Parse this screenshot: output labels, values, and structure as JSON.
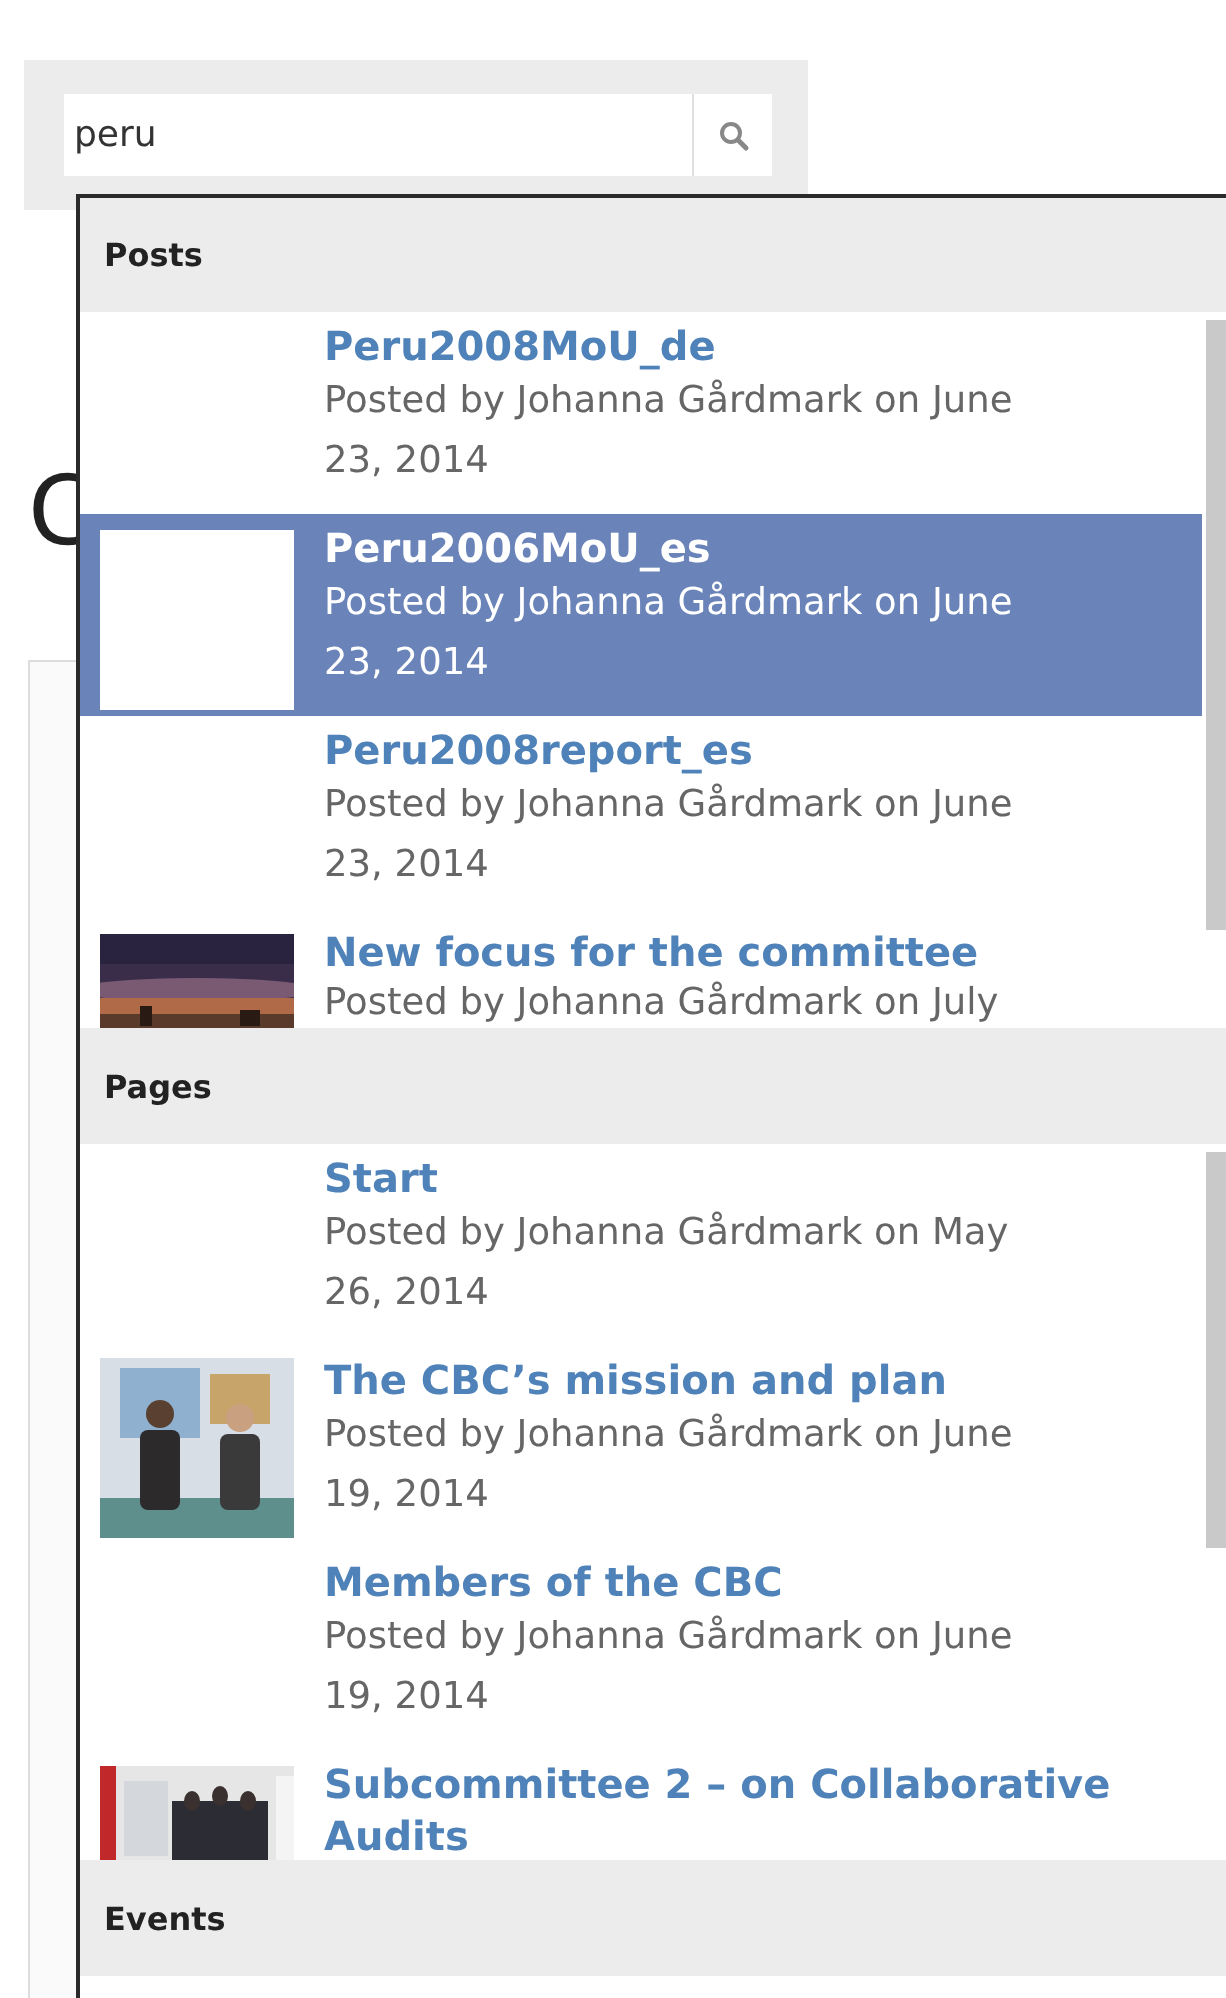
{
  "search": {
    "value": "peru"
  },
  "heading": "C",
  "sections": [
    {
      "title": "Posts",
      "items": [
        {
          "title": "Peru2008MoU_de",
          "meta": "Posted by Johanna Gårdmark on June 23, 2014",
          "selected": false,
          "kind": "text"
        },
        {
          "title": "Peru2006MoU_es",
          "meta": "Posted by Johanna Gårdmark on June 23, 2014",
          "selected": true,
          "kind": "blank"
        },
        {
          "title": "Peru2008report_es",
          "meta": "Posted by Johanna Gårdmark on June 23, 2014",
          "selected": false,
          "kind": "text"
        },
        {
          "title": "New focus for the committee",
          "meta": "Posted by Johanna Gårdmark on July",
          "selected": false,
          "kind": "picture"
        }
      ]
    },
    {
      "title": "Pages",
      "items": [
        {
          "title": "Start",
          "meta": "Posted by Johanna Gårdmark on May 26, 2014",
          "selected": false,
          "kind": "text"
        },
        {
          "title": "The CBC’s mission and plan",
          "meta": "Posted by Johanna Gårdmark on June 19, 2014",
          "selected": false,
          "kind": "picture"
        },
        {
          "title": "Members of the CBC",
          "meta": "Posted by Johanna Gårdmark on June 19, 2014",
          "selected": false,
          "kind": "text"
        },
        {
          "title": "Subcommittee 2 – on Collaborative Audits",
          "selected": false,
          "kind": "picture"
        }
      ]
    },
    {
      "title": "Events"
    }
  ]
}
